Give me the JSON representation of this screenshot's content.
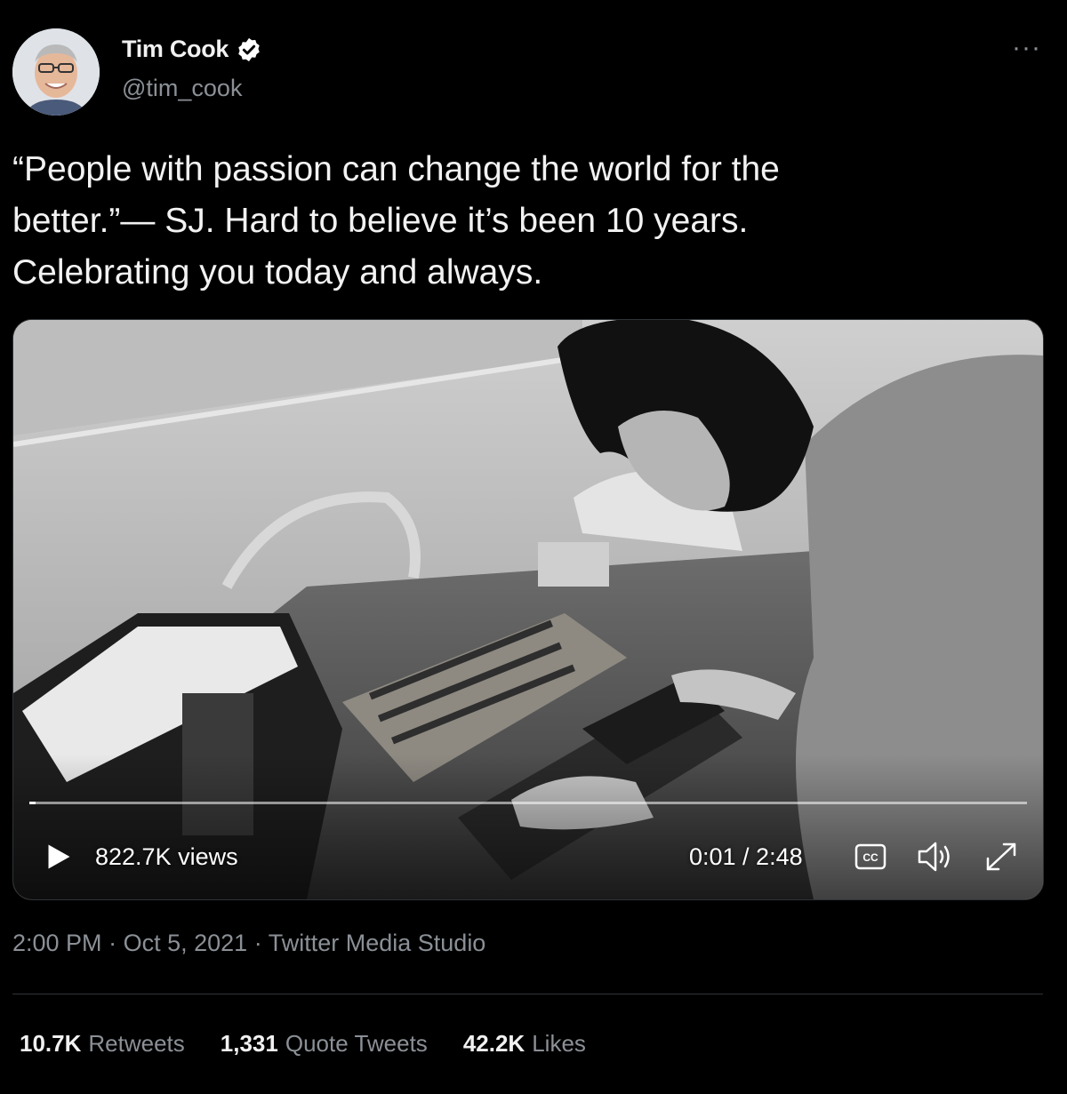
{
  "author": {
    "display_name": "Tim Cook",
    "handle": "@tim_cook",
    "verified": true,
    "avatar_icon": "profile-photo"
  },
  "more_icon": "more-options-icon",
  "tweet": {
    "lines": [
      "“People with passion can change the world for the",
      "better.”— SJ. Hard to believe it’s been 10 years.",
      "Celebrating you today and always."
    ]
  },
  "video": {
    "views": "822.7K views",
    "time": "0:01 / 2:48",
    "progress": 0.006,
    "controls": [
      "play-icon",
      "captions-icon",
      "volume-icon",
      "fullscreen-icon"
    ],
    "cc_label": "CC"
  },
  "meta": {
    "time": "2:00 PM",
    "separator": "·",
    "date": "Oct 5, 2021",
    "source": "Twitter Media Studio"
  },
  "stats": {
    "retweets": {
      "count": "10.7K",
      "label": "Retweets"
    },
    "quotes": {
      "count": "1,331",
      "label": "Quote Tweets"
    },
    "likes": {
      "count": "42.2K",
      "label": "Likes"
    }
  },
  "colors": {
    "background": "#000000",
    "text": "#e7e9ea",
    "secondary": "#8b9096",
    "verified_badge": "#ffffff"
  }
}
